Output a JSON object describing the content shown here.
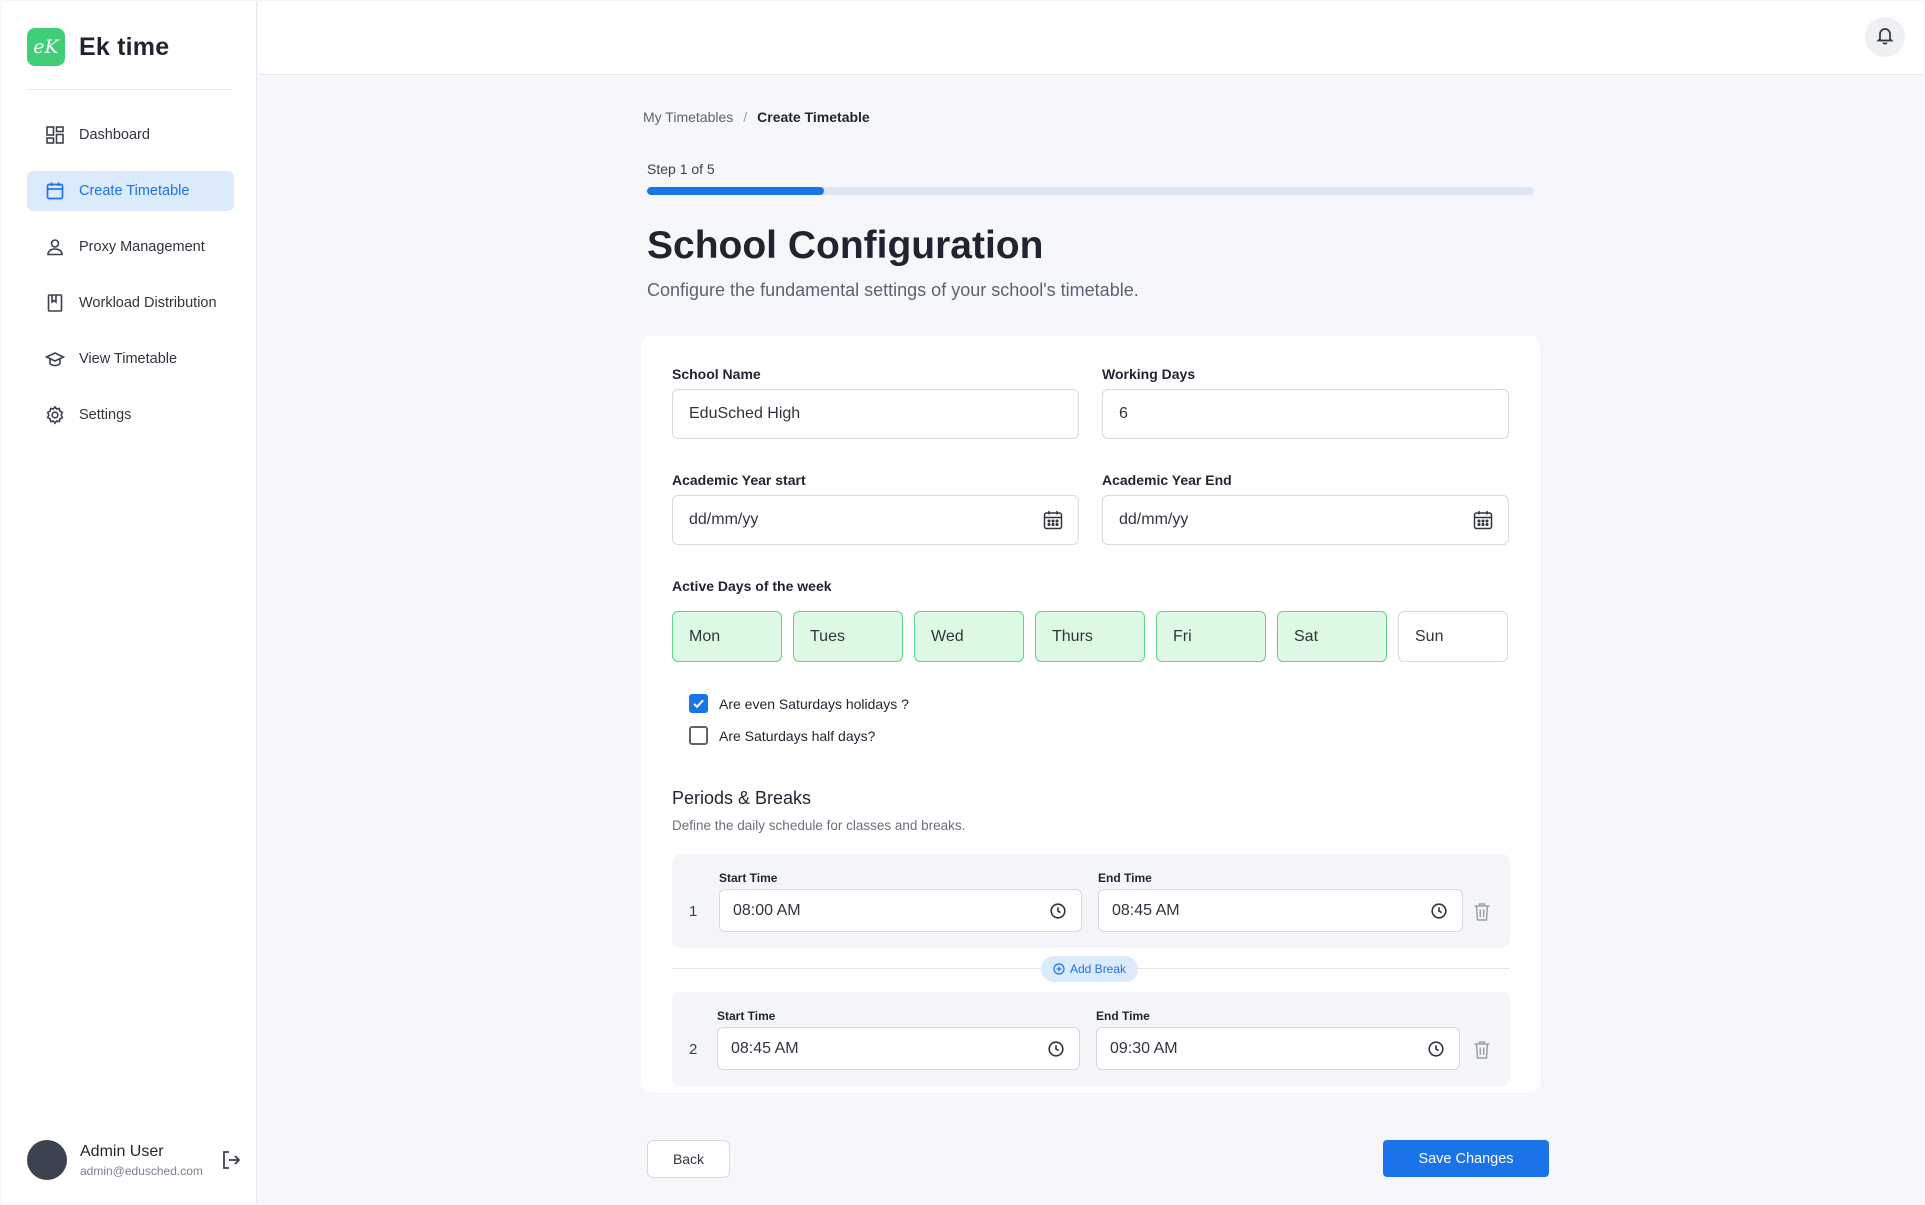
{
  "app": {
    "name": "Ek time",
    "logo_text": "eK"
  },
  "sidebar": {
    "items": [
      {
        "label": "Dashboard",
        "icon": "dashboard-icon",
        "active": false
      },
      {
        "label": "Create Timetable",
        "icon": "calendar-icon",
        "active": true
      },
      {
        "label": "Proxy Management",
        "icon": "user-icon",
        "active": false
      },
      {
        "label": "Workload Distribution",
        "icon": "book-icon",
        "active": false
      },
      {
        "label": "View Timetable",
        "icon": "graduation-cap-icon",
        "active": false
      },
      {
        "label": "Settings",
        "icon": "gear-icon",
        "active": false
      }
    ],
    "user": {
      "name": "Admin User",
      "email": "admin@edusched.com"
    }
  },
  "breadcrumb": {
    "parent": "My Timetables",
    "separator": "/",
    "current": "Create Timetable"
  },
  "progress": {
    "label": "Step 1 of 5",
    "fraction": 0.2
  },
  "page": {
    "title": "School Configuration",
    "subtitle": "Configure the fundamental settings of your school's timetable."
  },
  "form": {
    "school_name": {
      "label": "School Name",
      "value": "EduSched High"
    },
    "working_days": {
      "label": "Working Days",
      "value": "6"
    },
    "year_start": {
      "label": "Academic Year start",
      "placeholder": "dd/mm/yy"
    },
    "year_end": {
      "label": "Academic Year End",
      "placeholder": "dd/mm/yy"
    },
    "active_days_label": "Active Days of the week",
    "days": [
      {
        "label": "Mon",
        "active": true
      },
      {
        "label": "Tues",
        "active": true
      },
      {
        "label": "Wed",
        "active": true
      },
      {
        "label": "Thurs",
        "active": true
      },
      {
        "label": "Fri",
        "active": true
      },
      {
        "label": "Sat",
        "active": true
      },
      {
        "label": "Sun",
        "active": false
      }
    ],
    "even_saturdays": {
      "label": "Are even Saturdays holidays ?",
      "checked": true
    },
    "half_saturdays": {
      "label": "Are Saturdays half days?",
      "checked": false
    }
  },
  "periods": {
    "title": "Periods & Breaks",
    "subtitle": "Define the daily schedule for classes and breaks.",
    "start_label": "Start Time",
    "end_label": "End Time",
    "add_break_label": "Add Break",
    "rows": [
      {
        "number": "1",
        "start": "08:00 AM",
        "end": "08:45 AM"
      },
      {
        "number": "2",
        "start": "08:45 AM",
        "end": "09:30 AM"
      }
    ]
  },
  "actions": {
    "back": "Back",
    "save": "Save Changes"
  },
  "colors": {
    "accent": "#1a73e8",
    "brand": "#3fcf78",
    "day_active_bg": "#ddf9e4",
    "day_active_border": "#63d38b"
  }
}
